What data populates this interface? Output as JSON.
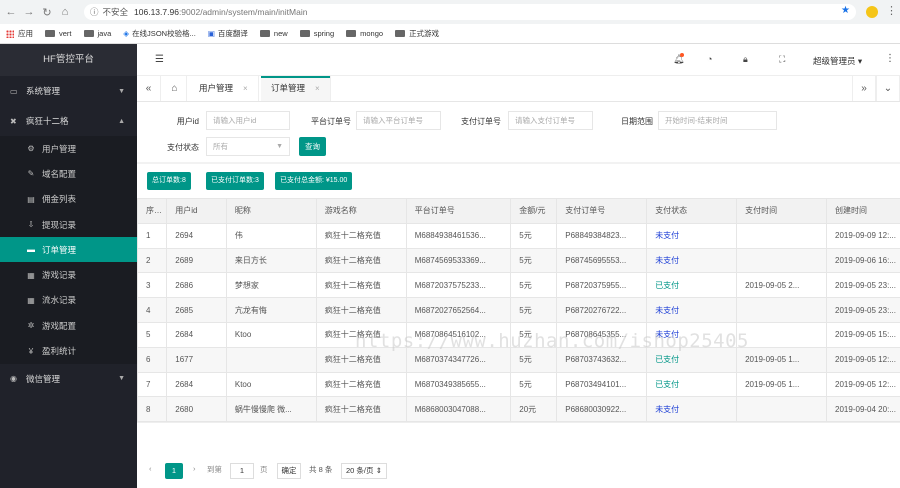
{
  "browser": {
    "insecure_label": "不安全",
    "url_host": "106.13.7.96",
    "url_path": ":9002/admin/system/main/initMain",
    "bookmarks": [
      "应用",
      "vert",
      "java",
      "在线JSON校验格...",
      "百度翻译",
      "new",
      "spring",
      "mongo",
      "正式游戏"
    ]
  },
  "sidebar": {
    "brand": "HF管控平台",
    "groups": [
      {
        "label": "系统管理"
      },
      {
        "label": "疯狂十二格"
      },
      {
        "label": "微信管理"
      }
    ],
    "items": [
      {
        "label": "用户管理",
        "icon": "gear-icon"
      },
      {
        "label": "域名配置",
        "icon": "brush-icon"
      },
      {
        "label": "佣金列表",
        "icon": "doc-icon"
      },
      {
        "label": "提现记录",
        "icon": "withdraw-icon"
      },
      {
        "label": "订单管理",
        "icon": "card-icon"
      },
      {
        "label": "游戏记录",
        "icon": "grid-icon"
      },
      {
        "label": "流水记录",
        "icon": "grid-icon"
      },
      {
        "label": "游戏配置",
        "icon": "settings-icon"
      },
      {
        "label": "盈利统计",
        "icon": "yen-icon"
      }
    ]
  },
  "header": {
    "admin_label": "超级管理员"
  },
  "tabs": [
    {
      "label": "用户管理"
    },
    {
      "label": "订单管理"
    }
  ],
  "filter": {
    "user_id_label": "用户id",
    "user_id_placeholder": "请输入用户id",
    "platform_order_label": "平台订单号",
    "platform_order_placeholder": "请输入平台订单号",
    "pay_order_label": "支付订单号",
    "pay_order_placeholder": "请输入支付订单号",
    "date_label": "日期范围",
    "date_placeholder": "开始时间-结束时间",
    "status_label": "支付状态",
    "status_value": "所有",
    "query_label": "查询"
  },
  "stats": {
    "total": "总订单数:8",
    "paid": "已支付订单数:3",
    "amount": "已支付总金额: ¥15.00"
  },
  "table": {
    "columns": [
      "序号",
      "用户id",
      "昵称",
      "游戏名称",
      "平台订单号",
      "金额/元",
      "支付订单号",
      "支付状态",
      "支付时间",
      "创建时间"
    ],
    "rows": [
      [
        "1",
        "2694",
        "伟",
        "疯狂十二格充值",
        "M6884938461536...",
        "5元",
        "P68849384823...",
        "未支付",
        "",
        "2019-09-09 12:..."
      ],
      [
        "2",
        "2689",
        "来日方长",
        "疯狂十二格充值",
        "M6874569533369...",
        "5元",
        "P68745695553...",
        "未支付",
        "",
        "2019-09-06 16:..."
      ],
      [
        "3",
        "2686",
        "梦想家",
        "疯狂十二格充值",
        "M6872037575233...",
        "5元",
        "P68720375955...",
        "已支付",
        "2019-09-05 2...",
        "2019-09-05 23:..."
      ],
      [
        "4",
        "2685",
        "亢龙有悔",
        "疯狂十二格充值",
        "M6872027652564...",
        "5元",
        "P68720276722...",
        "未支付",
        "",
        "2019-09-05 23:..."
      ],
      [
        "5",
        "2684",
        "Ktoo",
        "疯狂十二格充值",
        "M6870864516102...",
        "5元",
        "P68708645355...",
        "未支付",
        "",
        "2019-09-05 15:..."
      ],
      [
        "6",
        "1677",
        "",
        "疯狂十二格充值",
        "M6870374347726...",
        "5元",
        "P68703743632...",
        "已支付",
        "2019-09-05 1...",
        "2019-09-05 12:..."
      ],
      [
        "7",
        "2684",
        "Ktoo",
        "疯狂十二格充值",
        "M6870349385655...",
        "5元",
        "P68703494101...",
        "已支付",
        "2019-09-05 1...",
        "2019-09-05 12:..."
      ],
      [
        "8",
        "2680",
        "蜗牛慢慢爬 微...",
        "疯狂十二格充值",
        "M6868003047088...",
        "20元",
        "P68680030922...",
        "未支付",
        "",
        "2019-09-04 20:..."
      ]
    ]
  },
  "pager": {
    "current": "1",
    "goto_label": "到第",
    "goto_value": "1",
    "page_unit": "页",
    "confirm_label": "确定",
    "total_label": "共 8 条",
    "page_size": "20 条/页"
  },
  "watermark": "https://www.huzhan.com/ishop25405",
  "colors": {
    "accent": "#009688",
    "sidebar_bg": "#20222a",
    "unpaid": "#1e3fd6"
  }
}
